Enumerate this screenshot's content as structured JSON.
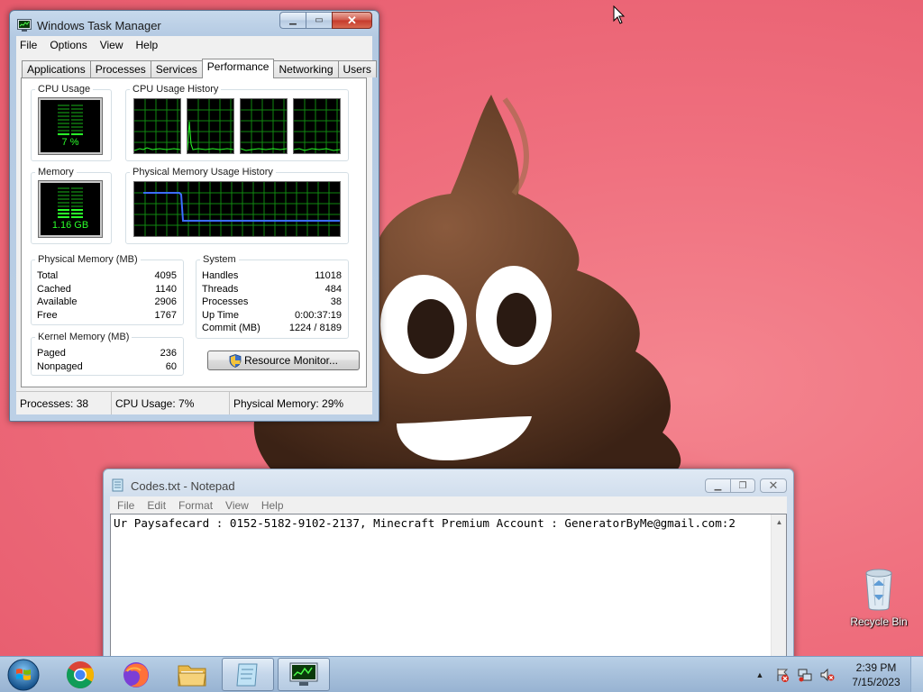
{
  "colors": {
    "accent_green": "#2aff2a",
    "grid_green": "#118811",
    "memory_line": "#3b6dff"
  },
  "taskmgr": {
    "title": "Windows Task Manager",
    "menu": [
      "File",
      "Options",
      "View",
      "Help"
    ],
    "tabs": [
      "Applications",
      "Processes",
      "Services",
      "Performance",
      "Networking",
      "Users"
    ],
    "active_tab": "Performance",
    "cpu_usage": {
      "label": "CPU Usage",
      "value": "7 %"
    },
    "cpu_history_label": "CPU Usage History",
    "memory": {
      "label": "Memory",
      "value": "1.16 GB"
    },
    "memory_history_label": "Physical Memory Usage History",
    "physical_memory": {
      "label": "Physical Memory (MB)",
      "rows": [
        {
          "name": "Total",
          "value": "4095"
        },
        {
          "name": "Cached",
          "value": "1140"
        },
        {
          "name": "Available",
          "value": "2906"
        },
        {
          "name": "Free",
          "value": "1767"
        }
      ]
    },
    "kernel_memory": {
      "label": "Kernel Memory (MB)",
      "rows": [
        {
          "name": "Paged",
          "value": "236"
        },
        {
          "name": "Nonpaged",
          "value": "60"
        }
      ]
    },
    "system": {
      "label": "System",
      "rows": [
        {
          "name": "Handles",
          "value": "11018"
        },
        {
          "name": "Threads",
          "value": "484"
        },
        {
          "name": "Processes",
          "value": "38"
        },
        {
          "name": "Up Time",
          "value": "0:00:37:19"
        },
        {
          "name": "Commit (MB)",
          "value": "1224 / 8189"
        }
      ]
    },
    "resource_monitor_button": "Resource Monitor...",
    "status": {
      "processes": "Processes: 38",
      "cpu": "CPU Usage: 7%",
      "memory": "Physical Memory: 29%"
    }
  },
  "notepad": {
    "title": "Codes.txt - Notepad",
    "menu": [
      "File",
      "Edit",
      "Format",
      "View",
      "Help"
    ],
    "content": "Ur Paysafecard : 0152-5182-9102-2137, Minecraft Premium Account : GeneratorByMe@gmail.com:2"
  },
  "desktop": {
    "recycle_bin_label": "Recycle Bin"
  },
  "taskbar": {
    "items": [
      "start-orb-icon",
      "chrome-icon",
      "firefox-icon",
      "explorer-folder-icon",
      "notepad-icon",
      "task-manager-icon"
    ],
    "clock_time": "2:39 PM",
    "clock_date": "7/15/2023"
  }
}
